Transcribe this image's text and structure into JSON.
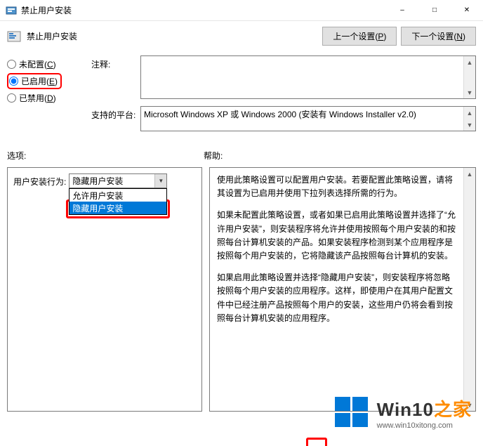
{
  "window": {
    "title": "禁止用户安装",
    "min_tooltip": "Minimize",
    "max_tooltip": "Maximize",
    "close_tooltip": "Close"
  },
  "header": {
    "title": "禁止用户安装",
    "prev_label": "上一个设置(",
    "prev_key": "P",
    "next_label": "下一个设置(",
    "next_key": "N",
    "close_paren": ")"
  },
  "radios": {
    "not_configured": "未配置(",
    "not_configured_key": "C",
    "enabled": "已启用(",
    "enabled_key": "E",
    "disabled": "已禁用(",
    "disabled_key": "D",
    "close_paren": ")"
  },
  "comment": {
    "label": "注释:",
    "value": ""
  },
  "platform": {
    "label": "支持的平台:",
    "value": "Microsoft Windows XP 或 Windows 2000 (安装有 Windows Installer v2.0)"
  },
  "options": {
    "section_label": "选项:",
    "behavior_label": "用户安装行为:",
    "combo_selected": "隐藏用户安装",
    "combo_items": [
      "允许用户安装",
      "隐藏用户安装"
    ]
  },
  "help": {
    "section_label": "帮助:",
    "p1": "使用此策略设置可以配置用户安装。若要配置此策略设置，请将其设置为已启用并使用下拉列表选择所需的行为。",
    "p2": "如果未配置此策略设置，或者如果已启用此策略设置并选择了“允许用户安装”，则安装程序将允许并使用按照每个用户安装的和按照每台计算机安装的产品。如果安装程序检测到某个应用程序是按照每个用户安装的，它将隐藏该产品按照每台计算机的安装。",
    "p3": "如果启用此策略设置并选择“隐藏用户安装”，则安装程序将忽略按照每个用户安装的应用程序。这样，即使用户在其用户配置文件中已经注册产品按照每个用户的安装，这些用户仍将会看到按照每台计算机安装的应用程序。"
  },
  "watermark": {
    "brand_prefix": "Win10",
    "brand_suffix": "之家",
    "url": "www.win10xitong.com"
  }
}
